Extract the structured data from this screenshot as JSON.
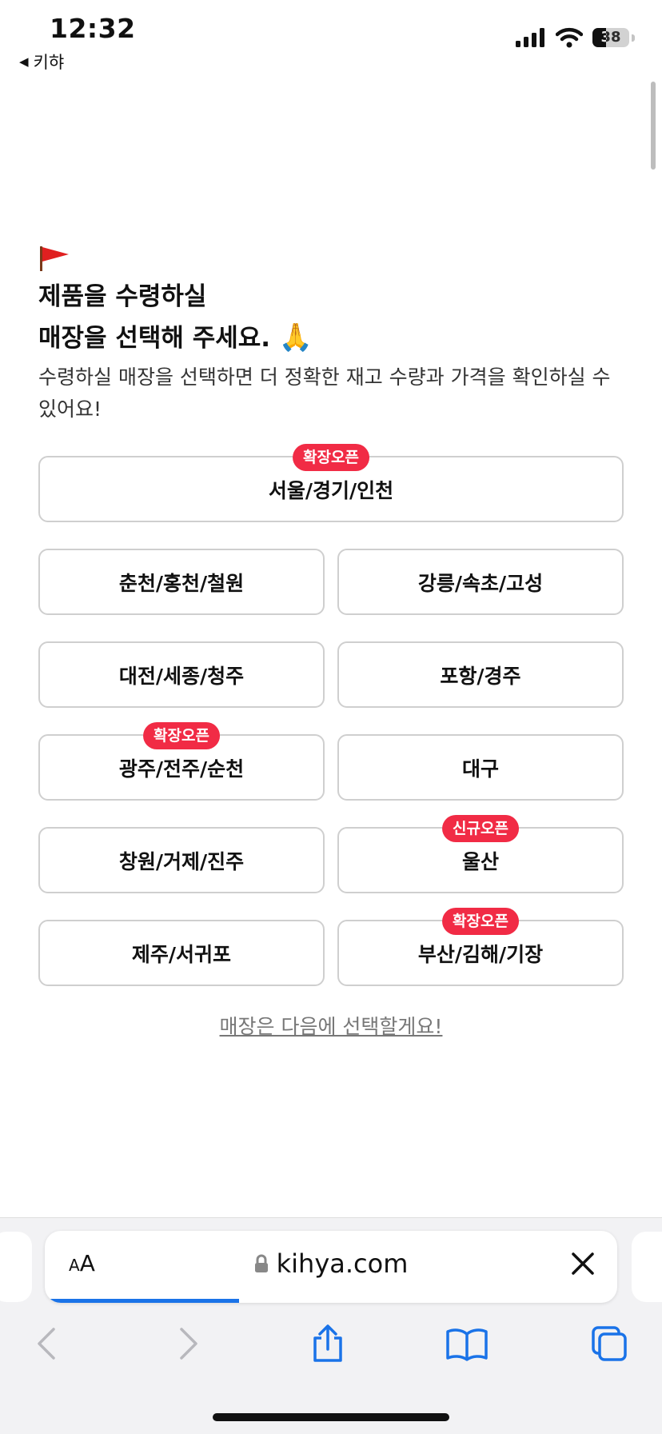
{
  "status_bar": {
    "time": "12:32",
    "back_app": "키햐",
    "battery": "38",
    "battery_level": 0.38
  },
  "intro": {
    "title_line1": "제품을 수령하실",
    "title_line2": "매장을 선택해 주세요.",
    "title_emoji": "🙏",
    "subtitle": "수령하실 매장을 선택하면 더 정확한 재고 수량과 가격을 확인하실 수 있어요!"
  },
  "regions": [
    {
      "label": "서울/경기/인천",
      "badge": "확장오픈"
    },
    {
      "label": "춘천/홍천/철원",
      "badge": ""
    },
    {
      "label": "강릉/속초/고성",
      "badge": ""
    },
    {
      "label": "대전/세종/청주",
      "badge": ""
    },
    {
      "label": "포항/경주",
      "badge": ""
    },
    {
      "label": "광주/전주/순천",
      "badge": "확장오픈"
    },
    {
      "label": "대구",
      "badge": ""
    },
    {
      "label": "창원/거제/진주",
      "badge": ""
    },
    {
      "label": "울산",
      "badge": "신규오픈"
    },
    {
      "label": "제주/서귀포",
      "badge": ""
    },
    {
      "label": "부산/김해/기장",
      "badge": "확장오픈"
    }
  ],
  "skip_link": "매장은 다음에 선택할게요!",
  "browser": {
    "aa_small": "A",
    "aa_large": "A",
    "url": "kihya.com",
    "load_progress": 0.34
  },
  "colors": {
    "badge": "#f12b45",
    "border": "#cfcfcf",
    "progress": "#1a73e8"
  }
}
